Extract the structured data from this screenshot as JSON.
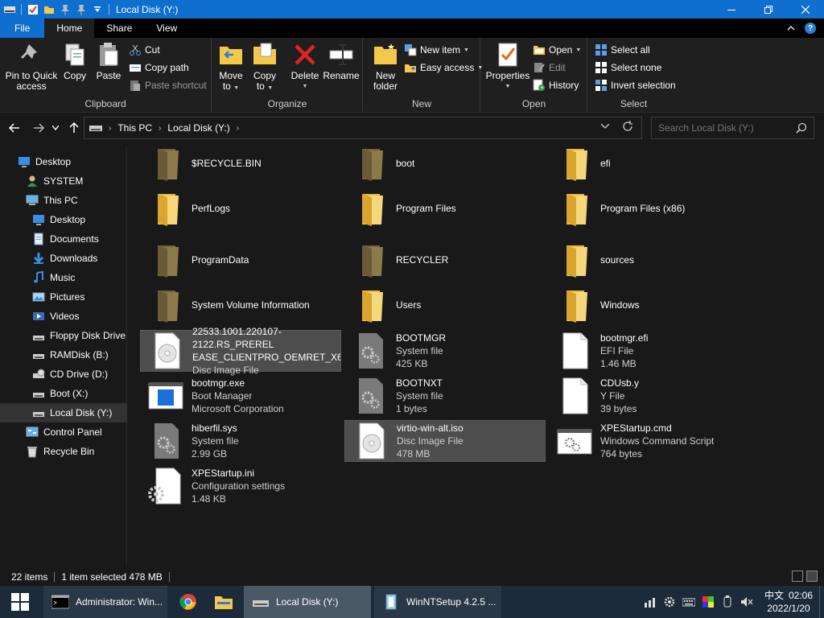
{
  "window": {
    "title": "Local Disk (Y:)"
  },
  "tabs": {
    "file": "File",
    "home": "Home",
    "share": "Share",
    "view": "View"
  },
  "ribbon": {
    "clipboard": {
      "label": "Clipboard",
      "pin": "Pin to Quick access",
      "pin_line1": "Pin to Quick",
      "pin_line2": "access",
      "copy": "Copy",
      "paste": "Paste",
      "cut": "Cut",
      "copy_path": "Copy path",
      "paste_shortcut": "Paste shortcut"
    },
    "organize": {
      "label": "Organize",
      "move_to_1": "Move",
      "move_to_2": "to",
      "copy_to_1": "Copy",
      "copy_to_2": "to",
      "delete": "Delete",
      "rename": "Rename"
    },
    "new": {
      "label": "New",
      "new_folder_1": "New",
      "new_folder_2": "folder",
      "new_item": "New item",
      "easy_access": "Easy access"
    },
    "open": {
      "label": "Open",
      "properties": "Properties",
      "open": "Open",
      "edit": "Edit",
      "history": "History"
    },
    "select": {
      "label": "Select",
      "select_all": "Select all",
      "select_none": "Select none",
      "invert": "Invert selection"
    }
  },
  "address": {
    "crumbs": [
      "This PC",
      "Local Disk (Y:)"
    ],
    "search_placeholder": "Search Local Disk (Y:)"
  },
  "nav": [
    {
      "label": "Desktop",
      "icon": "desktop-icon",
      "indent": 1
    },
    {
      "label": "SYSTEM",
      "icon": "user-icon",
      "indent": 2
    },
    {
      "label": "This PC",
      "icon": "pc-icon",
      "indent": 2
    },
    {
      "label": "Desktop",
      "icon": "desktop-icon",
      "indent": 3
    },
    {
      "label": "Documents",
      "icon": "documents-icon",
      "indent": 3
    },
    {
      "label": "Downloads",
      "icon": "downloads-icon",
      "indent": 3
    },
    {
      "label": "Music",
      "icon": "music-icon",
      "indent": 3
    },
    {
      "label": "Pictures",
      "icon": "pictures-icon",
      "indent": 3
    },
    {
      "label": "Videos",
      "icon": "videos-icon",
      "indent": 3
    },
    {
      "label": "Floppy Disk Drive",
      "icon": "floppy-icon",
      "indent": 3
    },
    {
      "label": "RAMDisk (B:)",
      "icon": "drive-icon",
      "indent": 3
    },
    {
      "label": "CD Drive (D:)",
      "icon": "cd-drive-icon",
      "indent": 3
    },
    {
      "label": "Boot (X:)",
      "icon": "drive-icon",
      "indent": 3
    },
    {
      "label": "Local Disk (Y:)",
      "icon": "drive-icon",
      "indent": 3
    },
    {
      "label": "Control Panel",
      "icon": "control-panel-icon",
      "indent": 2
    },
    {
      "label": "Recycle Bin",
      "icon": "recycle-bin-icon",
      "indent": 2
    }
  ],
  "files": [
    {
      "name": "$RECYCLE.BIN",
      "type": "folder-dark"
    },
    {
      "name": "boot",
      "type": "folder-dark"
    },
    {
      "name": "efi",
      "type": "folder"
    },
    {
      "name": "PerfLogs",
      "type": "folder"
    },
    {
      "name": "Program Files",
      "type": "folder"
    },
    {
      "name": "Program Files (x86)",
      "type": "folder"
    },
    {
      "name": "ProgramData",
      "type": "folder-dark"
    },
    {
      "name": "RECYCLER",
      "type": "folder-dark"
    },
    {
      "name": "sources",
      "type": "folder"
    },
    {
      "name": "System Volume Information",
      "type": "folder-dark"
    },
    {
      "name": "Users",
      "type": "folder"
    },
    {
      "name": "Windows",
      "type": "folder"
    },
    {
      "name": "22533.1001.220107-2122.RS_PRERELEASE_CLIENTPRO_OEMRET_X64F...",
      "line1": "22533.1001.220107-2122.RS_PRERELEASE_CLIENTPRO_OEMRET_X64F...",
      "line1a": "22533.1001.220107-2122.RS_PREREL",
      "line1b": "EASE_CLIENTPRO_OEMRET_X64F...",
      "sub1": "Disc Image File",
      "type": "disc",
      "hover": true
    },
    {
      "name": "BOOTMGR",
      "sub1": "System file",
      "sub2": "425 KB",
      "type": "sysfile"
    },
    {
      "name": "bootmgr.efi",
      "sub1": "EFI File",
      "sub2": "1.46 MB",
      "type": "blank"
    },
    {
      "name": "bootmgr.exe",
      "sub1": "Boot Manager",
      "sub2": "Microsoft Corporation",
      "type": "exe"
    },
    {
      "name": "BOOTNXT",
      "sub1": "System file",
      "sub2": "1 bytes",
      "type": "sysfile"
    },
    {
      "name": "CDUsb.y",
      "sub1": "Y File",
      "sub2": "39 bytes",
      "type": "blank"
    },
    {
      "name": "hiberfil.sys",
      "sub1": "System file",
      "sub2": "2.99 GB",
      "type": "sysfile"
    },
    {
      "name": "virtio-win-alt.iso",
      "sub1": "Disc Image File",
      "sub2": "478 MB",
      "type": "disc",
      "selected": true
    },
    {
      "name": "XPEStartup.cmd",
      "sub1": "Windows Command Script",
      "sub2": "764 bytes",
      "type": "cmd"
    },
    {
      "name": "XPEStartup.ini",
      "sub1": "Configuration settings",
      "sub2": "1.48 KB",
      "type": "ini"
    }
  ],
  "status": {
    "items": "22 items",
    "selected": "1 item selected  478 MB"
  },
  "taskbar": {
    "cmd": "Administrator: Win...",
    "explorer": "Local Disk (Y:)",
    "winntsetup": "WinNTSetup 4.2.5  ...",
    "time": "02:06",
    "date": "2022/1/20",
    "ime": "中文"
  },
  "colors": {
    "accent": "#0f6fcf",
    "folder": "#f5c84c",
    "folder_dark": "#8c7a4b",
    "selection": "#4d4d4d"
  }
}
